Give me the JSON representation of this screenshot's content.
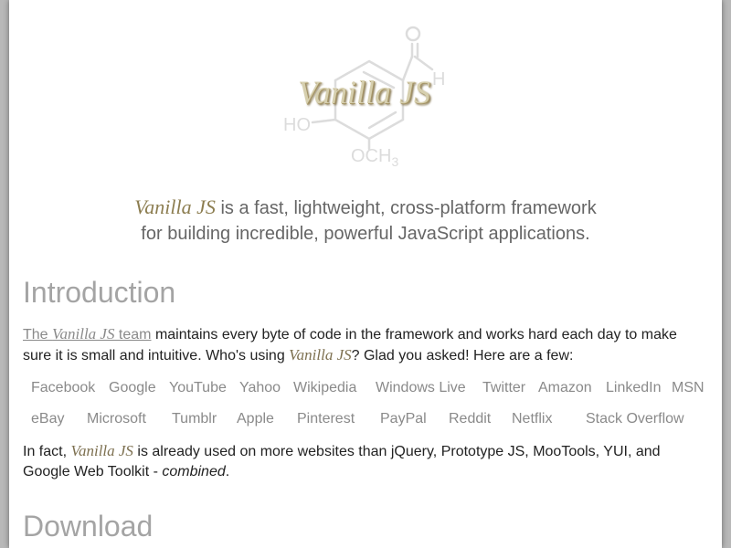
{
  "logo": {
    "text": "Vanilla JS",
    "chem_ho": "HO",
    "chem_h": "H",
    "chem_och": "OCH",
    "chem_sub": "3"
  },
  "tagline": {
    "brand": "Vanilla JS",
    "line1_rest": " is a fast, lightweight, cross-platform framework",
    "line2": "for building incredible, powerful JavaScript applications."
  },
  "introduction": {
    "heading": "Introduction",
    "link_prefix": "The ",
    "link_brand": "Vanilla JS",
    "link_suffix": " team",
    "text_part1": " maintains every byte of code in the framework and works hard each day to make sure it is small and intuitive. Who's using ",
    "brand": "Vanilla JS",
    "text_part2": "? Glad you asked! Here are a few:",
    "users": [
      "Facebook",
      "Google",
      "YouTube",
      "Yahoo",
      "Wikipedia",
      "Windows Live",
      "Twitter",
      "Amazon",
      "LinkedIn",
      "MSN",
      "eBay",
      "Microsoft",
      "Tumblr",
      "Apple",
      "Pinterest",
      "PayPal",
      "Reddit",
      "Netflix",
      "Stack Overflow"
    ],
    "fact_prefix": "In fact, ",
    "fact_brand": "Vanilla JS",
    "fact_text": " is already used on more websites than jQuery, Prototype JS, MooTools, YUI, and Google Web Toolkit - ",
    "fact_em": "combined",
    "fact_end": "."
  },
  "download": {
    "heading": "Download"
  },
  "colors": {
    "page_bg": "#ffffff",
    "outer_bg": "#b8b8b8",
    "heading": "#a4a4a4",
    "brand": "#9a8a5a",
    "muted_link": "#8a8a8a"
  }
}
